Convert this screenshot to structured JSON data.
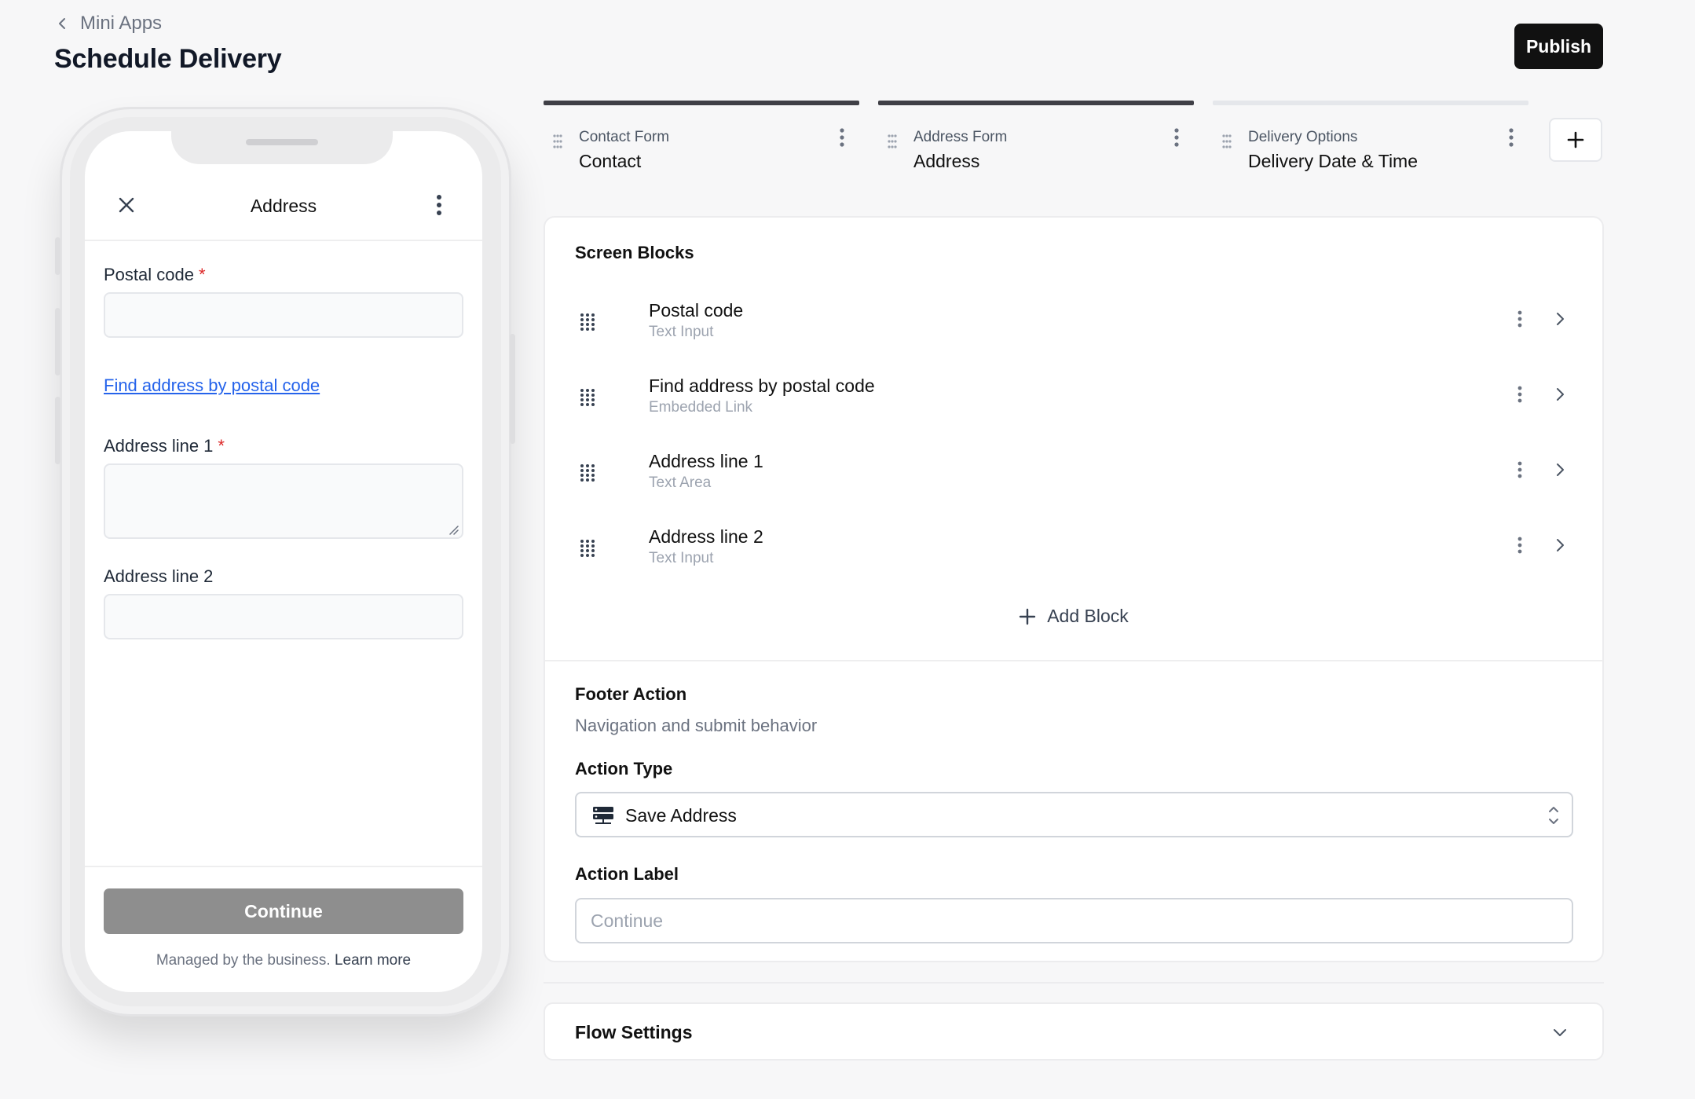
{
  "header": {
    "back_label": "Mini Apps",
    "title": "Schedule Delivery",
    "publish_label": "Publish"
  },
  "phone": {
    "screen_title": "Address",
    "fields": {
      "postal_code_label": "Postal code",
      "required_mark": "*",
      "find_link": "Find address by postal code",
      "address1_label": "Address line 1",
      "address2_label": "Address line 2"
    },
    "continue_label": "Continue",
    "managed_text": "Managed by the business.",
    "learn_more": "Learn more"
  },
  "screens": [
    {
      "kicker": "Contact Form",
      "name": "Contact",
      "active": true
    },
    {
      "kicker": "Address Form",
      "name": "Address",
      "active": true
    },
    {
      "kicker": "Delivery Options",
      "name": "Delivery Date & Time",
      "active": false
    }
  ],
  "blocks_section": {
    "title": "Screen Blocks",
    "blocks": [
      {
        "title": "Postal code",
        "type": "Text Input"
      },
      {
        "title": "Find address by postal code",
        "type": "Embedded Link"
      },
      {
        "title": "Address line 1",
        "type": "Text Area"
      },
      {
        "title": "Address line 2",
        "type": "Text Input"
      }
    ],
    "add_block_label": "Add Block"
  },
  "footer_action": {
    "title": "Footer Action",
    "subtitle": "Navigation and submit behavior",
    "action_type_label": "Action Type",
    "action_type_value": "Save Address",
    "action_label_label": "Action Label",
    "action_label_placeholder": "Continue"
  },
  "flow_settings": {
    "title": "Flow Settings"
  },
  "colors": {
    "accent_dark": "#111111",
    "link_blue": "#2563eb",
    "required_red": "#dc2626",
    "continue_disabled": "#8e8e8e",
    "tab_active_bar": "#3f3f46",
    "tab_inactive_bar": "#e5e7eb"
  }
}
